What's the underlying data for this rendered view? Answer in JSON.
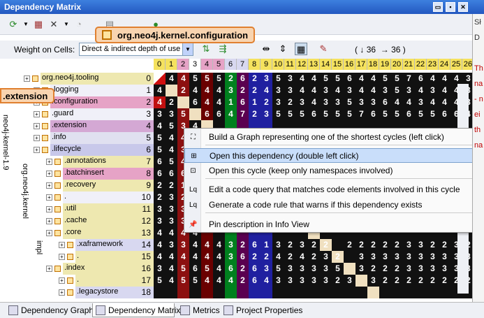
{
  "window": {
    "title": "Dependency Matrix"
  },
  "toolbar": {
    "weight_label": "Weight on Cells:",
    "weight_value": "Direct & indirect depth of use",
    "count_a": "36",
    "count_b": "36",
    "count_arrow_a": "↓",
    "count_arrow_b": "→"
  },
  "callouts": {
    "namespace": "org.neo4j.kernel.configuration",
    "row": ".extension"
  },
  "columns": [
    "0",
    "1",
    "2",
    "3",
    "4",
    "5",
    "6",
    "7",
    "8",
    "9",
    "10",
    "11",
    "12",
    "13",
    "14",
    "15",
    "16",
    "17",
    "18",
    "19",
    "20",
    "21",
    "22",
    "23",
    "24",
    "25",
    "26"
  ],
  "tree": {
    "assembly": "neo4j-kernel-1.9",
    "group_a": "org.neo4j.kernel",
    "group_b": "impl"
  },
  "rows": [
    {
      "label": "org.neo4j.tooling",
      "num": "0"
    },
    {
      "label": ".logging",
      "num": "1"
    },
    {
      "label": ".configuration",
      "num": "2"
    },
    {
      "label": ".guard",
      "num": "3"
    },
    {
      "label": ".extension",
      "num": "4"
    },
    {
      "label": ".info",
      "num": "5"
    },
    {
      "label": ".lifecycle",
      "num": "6"
    },
    {
      "label": ".annotations",
      "num": "7"
    },
    {
      "label": ".batchinsert",
      "num": "8"
    },
    {
      "label": ".recovery",
      "num": "9"
    },
    {
      "label": ".",
      "num": "10"
    },
    {
      "label": ".util",
      "num": "11"
    },
    {
      "label": ".cache",
      "num": "12"
    },
    {
      "label": ".core",
      "num": "13"
    },
    {
      "label": ".xaframework",
      "num": "14"
    },
    {
      "label": ".",
      "num": "15"
    },
    {
      "label": ".index",
      "num": "16"
    },
    {
      "label": ".",
      "num": "17"
    },
    {
      "label": ".legacystore",
      "num": "18"
    }
  ],
  "matrix": [
    [
      "",
      "4",
      "4",
      "5",
      "5",
      "5",
      "2",
      "6",
      "2",
      "3",
      "5",
      "3",
      "4",
      "4",
      "5",
      "5",
      "6",
      "4",
      "4",
      "5",
      "5",
      "7",
      "6",
      "4",
      "4",
      "4",
      "3"
    ],
    [
      "4",
      "",
      "2",
      "4",
      "4",
      "4",
      "3",
      "2",
      "2",
      "4",
      "3",
      "3",
      "4",
      "4",
      "3",
      "4",
      "3",
      "4",
      "4",
      "3",
      "5",
      "3",
      "4",
      "3",
      "4",
      "4",
      "3"
    ],
    [
      "4",
      "2",
      "",
      "6",
      "4",
      "4",
      "1",
      "6",
      "1",
      "2",
      "3",
      "2",
      "3",
      "4",
      "3",
      "3",
      "5",
      "3",
      "3",
      "6",
      "4",
      "4",
      "3",
      "4",
      "4",
      "4",
      "3"
    ],
    [
      "3",
      "3",
      "5",
      "",
      "6",
      "6",
      "4",
      "7",
      "2",
      "3",
      "5",
      "5",
      "5",
      "6",
      "5",
      "5",
      "5",
      "7",
      "6",
      "5",
      "5",
      "6",
      "5",
      "5",
      "6",
      "6",
      "4"
    ],
    [
      "4",
      "5",
      "3",
      "4",
      "",
      "",
      "",
      "",
      "",
      "",
      "",
      "",
      "",
      "",
      "",
      "",
      "",
      "",
      "",
      "",
      "",
      "",
      "",
      "",
      "",
      "",
      ""
    ],
    [
      "5",
      "4",
      "4",
      "4",
      "",
      "",
      "",
      "",
      "",
      "",
      "",
      "",
      "",
      "",
      "",
      "",
      "",
      "",
      "",
      "",
      "",
      "",
      "",
      "",
      "",
      "",
      ""
    ],
    [
      "5",
      "4",
      "3",
      "4",
      "",
      "",
      "",
      "",
      "",
      "",
      "",
      "",
      "",
      "",
      "",
      "",
      "",
      "",
      "",
      "",
      "",
      "",
      "",
      "",
      "",
      "",
      ""
    ],
    [
      "6",
      "5",
      "4",
      "4",
      "",
      "",
      "",
      "",
      "",
      "",
      "",
      "",
      "",
      "",
      "",
      "",
      "",
      "",
      "",
      "",
      "",
      "",
      "",
      "",
      "",
      "",
      ""
    ],
    [
      "6",
      "6",
      "6",
      "4",
      "",
      "",
      "",
      "",
      "",
      "",
      "",
      "",
      "",
      "",
      "",
      "",
      "",
      "",
      "",
      "",
      "",
      "",
      "",
      "",
      "",
      "",
      ""
    ],
    [
      "2",
      "2",
      "1",
      "2",
      "",
      "",
      "",
      "",
      "",
      "",
      "",
      "",
      "",
      "",
      "",
      "",
      "",
      "",
      "",
      "",
      "",
      "",
      "",
      "",
      "",
      "",
      ""
    ],
    [
      "2",
      "3",
      "2",
      "2",
      "",
      "",
      "",
      "",
      "",
      "",
      "",
      "",
      "",
      "",
      "",
      "",
      "",
      "",
      "",
      "",
      "",
      "",
      "",
      "",
      "",
      "",
      ""
    ],
    [
      "3",
      "3",
      "3",
      "3",
      "",
      "",
      "",
      "",
      "",
      "",
      "",
      "",
      "",
      "",
      "",
      "",
      "",
      "",
      "",
      "",
      "",
      "",
      "",
      "",
      "",
      "",
      ""
    ],
    [
      "3",
      "3",
      "3",
      "3",
      "",
      "",
      "",
      "",
      "",
      "",
      "",
      "",
      "",
      "",
      "",
      "",
      "",
      "",
      "",
      "",
      "",
      "",
      "",
      "",
      "",
      "",
      ""
    ],
    [
      "4",
      "4",
      "4",
      "4",
      "",
      "",
      "",
      "",
      "",
      "",
      "",
      "",
      "",
      "",
      "",
      "",
      "",
      "",
      "",
      "",
      "",
      "",
      "",
      "",
      "",
      "",
      ""
    ],
    [
      "4",
      "3",
      "3",
      "4",
      "4",
      "4",
      "3",
      "2",
      "6",
      "1",
      "3",
      "2",
      "3",
      "2",
      "2",
      "",
      "2",
      "2",
      "2",
      "2",
      "2",
      "3",
      "3",
      "2",
      "2",
      "3",
      "2"
    ],
    [
      "4",
      "4",
      "4",
      "4",
      "4",
      "4",
      "3",
      "6",
      "2",
      "2",
      "4",
      "2",
      "4",
      "2",
      "3",
      "2",
      "",
      "3",
      "3",
      "3",
      "3",
      "3",
      "3",
      "3",
      "3",
      "3",
      "3"
    ],
    [
      "3",
      "4",
      "5",
      "6",
      "5",
      "4",
      "6",
      "2",
      "6",
      "3",
      "5",
      "3",
      "3",
      "3",
      "3",
      "5",
      "",
      "3",
      "2",
      "2",
      "2",
      "3",
      "3",
      "3",
      "3",
      "3",
      "3"
    ],
    [
      "5",
      "4",
      "5",
      "5",
      "4",
      "4",
      "4",
      "2",
      "6",
      "4",
      "3",
      "3",
      "3",
      "3",
      "3",
      "2",
      "3",
      "",
      "3",
      "2",
      "2",
      "2",
      "2",
      "2",
      "2",
      "2",
      "2"
    ],
    [
      "",
      "",
      "",
      "",
      "",
      "",
      "",
      "",
      "",
      "",
      "",
      "",
      "",
      "",
      "",
      "",
      "",
      "",
      "",
      "",
      "",
      "",
      "",
      "",
      "",
      "",
      ""
    ]
  ],
  "menu": {
    "items": [
      {
        "label": "Build a Graph representing one of the shortest cycles (left click)",
        "icon": "graph-icon"
      },
      {
        "label": "Open this dependency (double left click)",
        "icon": "matrix-icon"
      },
      {
        "label": "Open this cycle (keep only namespaces involved)",
        "icon": "cycle-icon"
      },
      {
        "label": "Edit a code query that matches code elements involved in this cycle",
        "icon": "linq-icon"
      },
      {
        "label": "Generate a code rule that warns if this dependency exists",
        "icon": "linq-icon"
      },
      {
        "label": "Pin description in Info View",
        "icon": "pin-icon"
      }
    ]
  },
  "tabs": [
    {
      "label": "Dependency Graph"
    },
    {
      "label": "Dependency Matrix"
    },
    {
      "label": "Metrics"
    },
    {
      "label": "Project Properties"
    }
  ],
  "right_panel": {
    "lines": [
      "Sł",
      "D",
      "",
      "Th",
      "na",
      "- n",
      "ei",
      "th",
      "na"
    ]
  },
  "colors": {
    "title_bg": "#2358c0",
    "highlight": "#c9defa",
    "callout_bg": "#f8d4b0",
    "callout_border": "#e08030"
  }
}
